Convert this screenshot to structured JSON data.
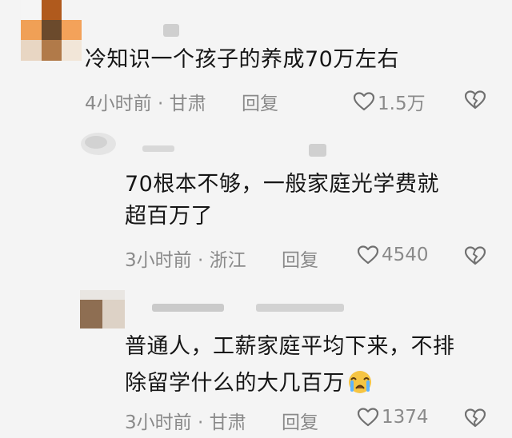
{
  "comments": [
    {
      "text": "冷知识一个孩子的养成70万左右",
      "meta": "4小时前 · 甘肃",
      "reply_label": "回复",
      "likes": "1.5万"
    },
    {
      "text_line1": "70根本不够，一般家庭光学费就",
      "text_line2": "超百万了",
      "meta": "3小时前 · 浙江",
      "reply_label": "回复",
      "likes": "4540"
    },
    {
      "text_line1": "普通人，工薪家庭平均下来，不排",
      "text_line2": "除留学什么的大几百万",
      "meta": "3小时前 · 甘肃",
      "reply_label": "回复",
      "likes": "1374"
    }
  ],
  "icons": {
    "like": "heart-outline-icon",
    "dislike": "broken-heart-icon",
    "emoji": "crying-face-emoji"
  },
  "colors": {
    "background": "#f4f4f4",
    "meta_text": "#8a8a8a",
    "body_text": "#161616"
  }
}
